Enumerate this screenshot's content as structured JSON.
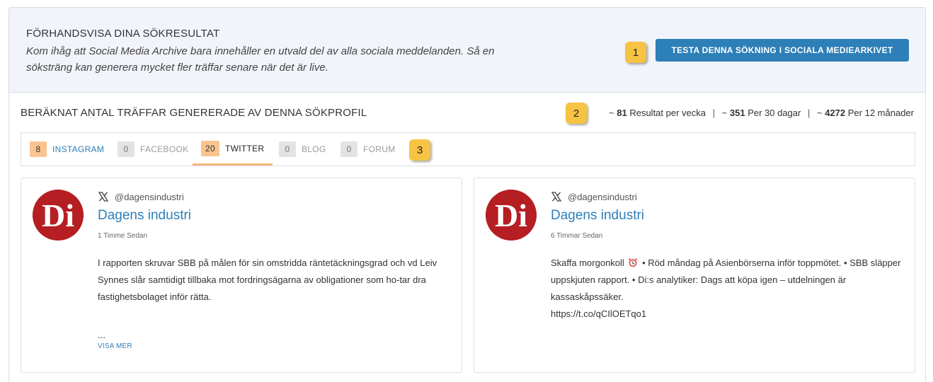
{
  "preview": {
    "title": "FÖRHANDSVISA DINA SÖKRESULTAT",
    "description": "Kom ihåg att Social Media Archive bara innehåller en utvald del av alla sociala meddelanden. Så en söksträng kan generera mycket fler träffar senare när det är live.",
    "test_button": "TESTA DENNA SÖKNING I SOCIALA MEDIEARKIVET"
  },
  "badges": [
    "1",
    "2",
    "3"
  ],
  "estimate": {
    "title": "BERÄKNAT ANTAL TRÄFFAR GENERERADE AV DENNA SÖKPROFIL",
    "prefix": "~",
    "week_value": "81",
    "week_label": "Resultat per vecka",
    "month_value": "351",
    "month_label": "Per 30 dagar",
    "year_value": "4272",
    "year_label": "Per 12 månader",
    "separator": "|"
  },
  "tabs": [
    {
      "count": "8",
      "label": "INSTAGRAM"
    },
    {
      "count": "0",
      "label": "FACEBOOK"
    },
    {
      "count": "20",
      "label": "TWITTER"
    },
    {
      "count": "0",
      "label": "BLOG"
    },
    {
      "count": "0",
      "label": "FORUM"
    }
  ],
  "posts": [
    {
      "avatar_text": "Di",
      "handle": "@dagensindustri",
      "author": "Dagens industri",
      "time": "1 Timme Sedan",
      "text": "I rapporten skruvar SBB på målen för sin omstridda räntetäckningsgrad och vd Leiv Synnes slår samtidigt tillbaka mot fordringsägarna av obligationer som ho-tar dra fastighetsbolaget inför rätta.",
      "ellipsis": "...",
      "show_more": "VISA MER"
    },
    {
      "avatar_text": "Di",
      "handle": "@dagensindustri",
      "author": "Dagens industri",
      "time": "6 Timmar Sedan",
      "text_start": "Skaffa morgonkoll",
      "text_rest": "• Röd måndag på Asienbörserna inför toppmötet. • SBB släpper uppskjuten rapport. • Di:s analytiker: Dags att köpa igen – utdelningen är kassaskåpssäker.",
      "link": "https://t.co/qCIlOETqo1"
    }
  ],
  "colors": {
    "accent": "#2d7fb8",
    "badge": "#f6c343",
    "tab_active_count": "#f9c48f",
    "avatar": "#b51e22"
  },
  "icons": [
    "x-logo-icon",
    "alarm-clock-icon"
  ]
}
